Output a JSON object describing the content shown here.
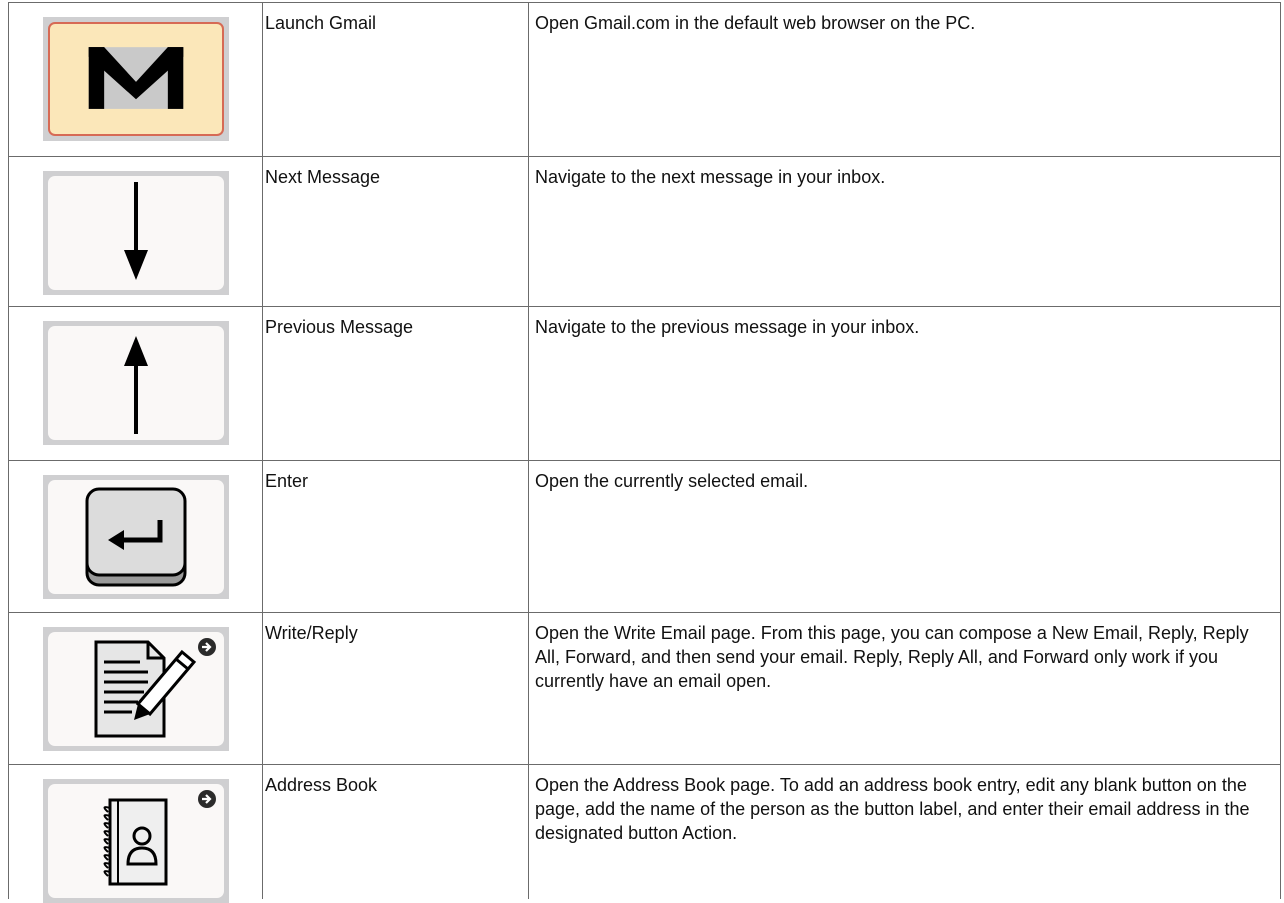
{
  "rows": [
    {
      "icon": "envelope-icon",
      "name": "Launch Gmail",
      "description": "Open Gmail.com in the default web browser on the PC."
    },
    {
      "icon": "arrow-down-icon",
      "name": "Next Message",
      "description": "Navigate to the next message in your inbox."
    },
    {
      "icon": "arrow-up-icon",
      "name": "Previous Message",
      "description": "Navigate to the previous message in your inbox."
    },
    {
      "icon": "enter-key-icon",
      "name": "Enter",
      "description": "Open the currently selected email."
    },
    {
      "icon": "document-pencil-icon",
      "name": "Write/Reply",
      "description": "Open the Write Email page. From this page, you can compose a New Email, Reply, Reply All, Forward, and then send your email. Reply, Reply All, and Forward only work if you currently have an email open."
    },
    {
      "icon": "address-book-icon",
      "name": "Address Book",
      "description": "Open the Address Book page. To add an address book entry, edit any blank button on the page, add the name of the person as the button label, and enter their email address in the designated button Action."
    }
  ],
  "colors": {
    "gmail_button_fill": "#fbe7b9",
    "gmail_button_border": "#d66a55",
    "button_frame": "#cfcfd1",
    "button_fill": "#faf8f7",
    "table_border": "#6b6b6b"
  }
}
